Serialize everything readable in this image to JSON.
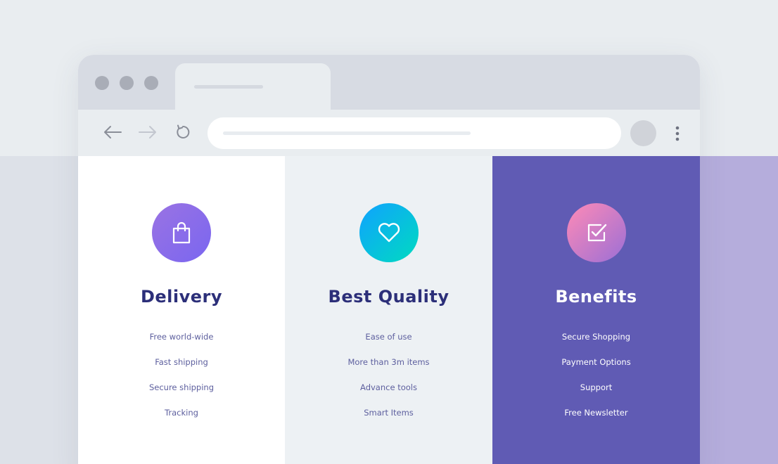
{
  "browser": {
    "toolbar": {
      "back": "arrow-left-icon",
      "forward": "arrow-right-icon",
      "reload": "reload-icon",
      "menu": "more-vertical-icon"
    }
  },
  "features": [
    {
      "icon": "shopping-bag-icon",
      "title": "Delivery",
      "items": [
        "Free world-wide",
        "Fast shipping",
        "Secure shipping",
        "Tracking"
      ]
    },
    {
      "icon": "heart-icon",
      "title": "Best Quality",
      "items": [
        "Ease of use",
        "More than 3m items",
        "Advance tools",
        "Smart Items"
      ]
    },
    {
      "icon": "check-square-icon",
      "title": "Benefits",
      "items": [
        "Secure Shopping",
        "Payment Options",
        "Support",
        "Free Newsletter"
      ]
    }
  ],
  "colors": {
    "background": "#e9edf0",
    "accent_purple": "#605bb4",
    "title_navy": "#2c2f79",
    "item_text": "#5d5f9e",
    "side_panel": "#b5addc"
  }
}
